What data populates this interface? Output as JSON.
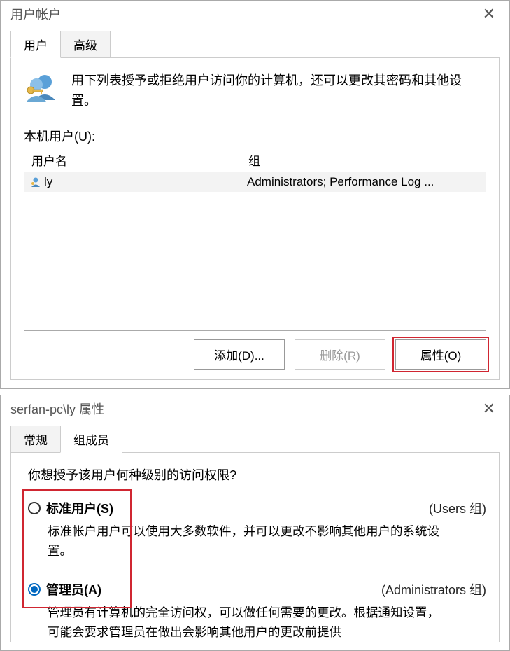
{
  "win1": {
    "title": "用户帐户",
    "tabs": {
      "users": "用户",
      "advanced": "高级"
    },
    "intro": "用下列表授予或拒绝用户访问你的计算机，还可以更改其密码和其他设置。",
    "local_users_label": "本机用户(U):",
    "columns": {
      "user": "用户名",
      "group": "组"
    },
    "rows": [
      {
        "user": "ly",
        "group": "Administrators; Performance Log ..."
      }
    ],
    "buttons": {
      "add": "添加(D)...",
      "remove": "删除(R)",
      "props": "属性(O)"
    }
  },
  "win2": {
    "title": "serfan-pc\\ly 属性",
    "tabs": {
      "general": "常规",
      "member": "组成员"
    },
    "question": "你想授予该用户何种级别的访问权限?",
    "standard": {
      "label": "标准用户(S)",
      "group": "(Users 组)",
      "desc": "标准帐户用户可以使用大多数软件，并可以更改不影响其他用户的系统设置。"
    },
    "admin": {
      "label": "管理员(A)",
      "group": "(Administrators 组)",
      "desc": "管理员有计算机的完全访问权，可以做任何需要的更改。根据通知设置，可能会要求管理员在做出会影响其他用户的更改前提供"
    }
  }
}
